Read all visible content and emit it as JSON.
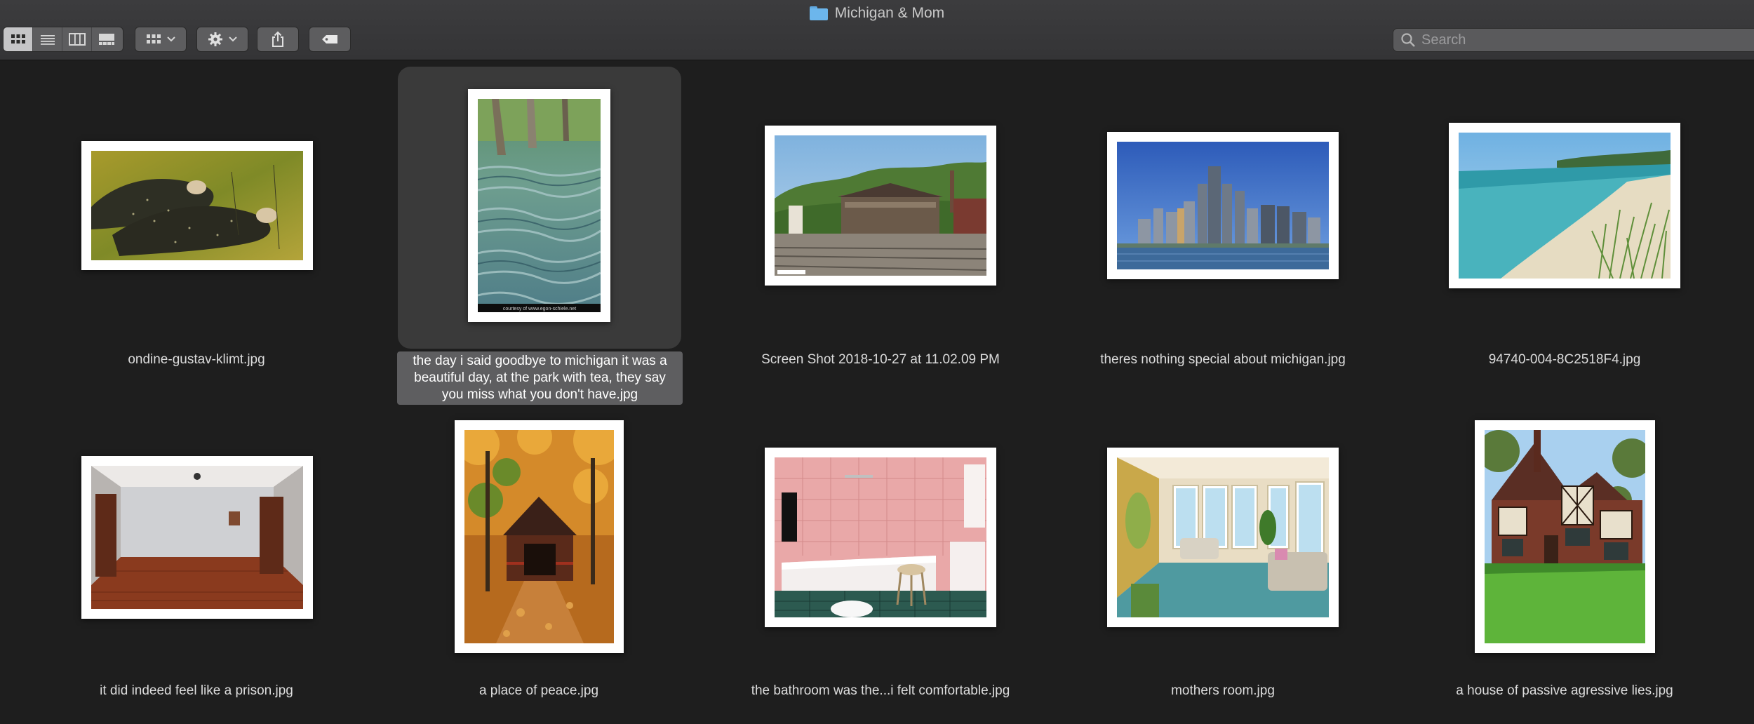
{
  "window": {
    "title": "Michigan & Mom"
  },
  "toolbar": {
    "view_modes": [
      "icon-view",
      "list-view",
      "column-view",
      "gallery-view"
    ],
    "active_view": "icon-view",
    "search_placeholder": "Search"
  },
  "files": [
    {
      "name": "ondine-gustav-klimt.jpg",
      "selected": false
    },
    {
      "name": "the day i said goodbye to michigan it was a beautiful day, at the park with tea, they say you miss what you don't have.jpg",
      "selected": true,
      "label_lines": [
        "the day i said goodbye to michigan it was a",
        "beautiful day, at the park with tea, they say",
        "you miss what you don't have.jpg"
      ],
      "thumb_caption": "courtesy of www.egon-schiele.net"
    },
    {
      "name": "Screen Shot 2018-10-27 at 11.02.09 PM",
      "selected": false
    },
    {
      "name": "theres nothing special about michigan.jpg",
      "selected": false
    },
    {
      "name": "94740-004-8C2518F4.jpg",
      "selected": false
    },
    {
      "name": "it did indeed feel like a prison.jpg",
      "selected": false
    },
    {
      "name": "a place of peace.jpg",
      "selected": false
    },
    {
      "name": "the bathroom was the...i felt comfortable.jpg",
      "selected": false
    },
    {
      "name": "mothers room.jpg",
      "selected": false
    },
    {
      "name": "a house of passive agressive lies.jpg",
      "selected": false
    }
  ],
  "colors": {
    "background": "#1e1e1e",
    "selection_bg": "#3a3a3a",
    "label_selected_bg": "#5e5e60",
    "folder_blue": "#6cb6ec"
  }
}
